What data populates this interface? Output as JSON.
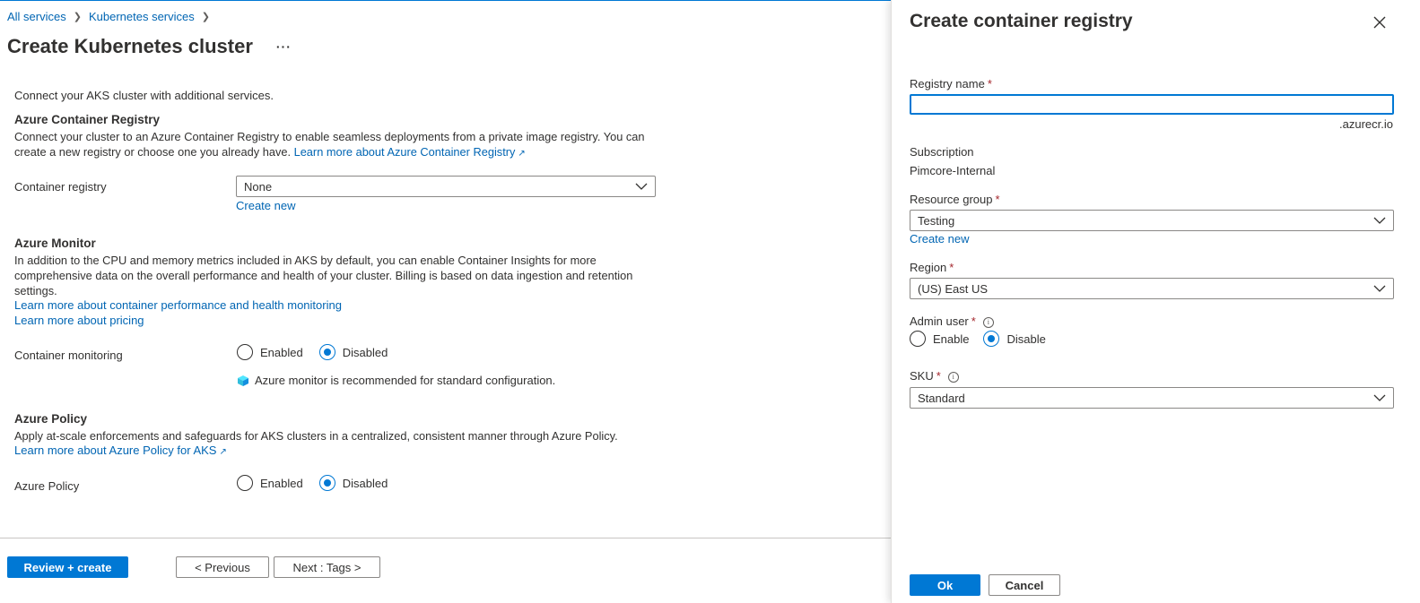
{
  "breadcrumb": {
    "items": [
      "All services",
      "Kubernetes services"
    ],
    "separator": ">"
  },
  "page": {
    "title": "Create Kubernetes cluster",
    "more": "···",
    "intro": "Connect your AKS cluster with additional services."
  },
  "acr": {
    "heading": "Azure Container Registry",
    "text": "Connect your cluster to an Azure Container Registry to enable seamless deployments from a private image registry. You can create a new registry or choose one you already have.",
    "link": "Learn more about Azure Container Registry",
    "field_label": "Container registry",
    "selected": "None",
    "create_new": "Create new"
  },
  "monitor": {
    "heading": "Azure Monitor",
    "text": "In addition to the CPU and memory metrics included in AKS by default, you can enable Container Insights for more comprehensive data on the overall performance and health of your cluster. Billing is based on data ingestion and retention settings.",
    "link1": "Learn more about container performance and health monitoring",
    "link2": "Learn more about pricing",
    "field_label": "Container monitoring",
    "options": [
      "Enabled",
      "Disabled"
    ],
    "selected": "Disabled",
    "info": "Azure monitor is recommended for standard configuration."
  },
  "policy": {
    "heading": "Azure Policy",
    "text": "Apply at-scale enforcements and safeguards for AKS clusters in a centralized, consistent manner through Azure Policy.",
    "link": "Learn more about Azure Policy for AKS",
    "field_label": "Azure Policy",
    "options": [
      "Enabled",
      "Disabled"
    ],
    "selected": "Disabled"
  },
  "footer": {
    "review_create": "Review + create",
    "previous": "< Previous",
    "next": "Next : Tags >"
  },
  "panel": {
    "title": "Create container registry",
    "registry_name_label": "Registry name",
    "registry_name_value": "",
    "registry_suffix": ".azurecr.io",
    "subscription_label": "Subscription",
    "subscription_value": "Pimcore-Internal",
    "resource_group_label": "Resource group",
    "resource_group_value": "Testing",
    "create_new": "Create new",
    "region_label": "Region",
    "region_value": "(US) East US",
    "admin_user_label": "Admin user",
    "admin_user_options": [
      "Enable",
      "Disable"
    ],
    "admin_user_selected": "Disable",
    "sku_label": "SKU",
    "sku_value": "Standard",
    "required_marker": "*",
    "ok": "Ok",
    "cancel": "Cancel"
  },
  "colors": {
    "accent": "#0078d4",
    "link": "#0065b3",
    "required": "#a4262c",
    "text": "#323130"
  },
  "icons": [
    "chevron-right-icon",
    "more-icon",
    "external-link-icon",
    "chevron-down-icon",
    "cube-icon",
    "info-icon",
    "close-icon"
  ]
}
